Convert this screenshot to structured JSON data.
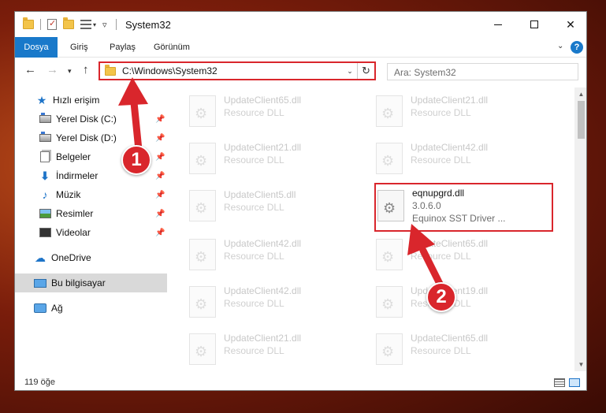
{
  "window": {
    "title": "System32",
    "controls": {
      "minimize_icon": "minimize-icon",
      "maximize_icon": "maximize-icon",
      "close_label": "✕"
    }
  },
  "ribbon": {
    "tabs": [
      {
        "label": "Dosya"
      },
      {
        "label": "Giriş"
      },
      {
        "label": "Paylaş"
      },
      {
        "label": "Görünüm"
      }
    ],
    "help_label": "?"
  },
  "nav": {
    "address": "C:\\Windows\\System32",
    "search_placeholder": "Ara: System32"
  },
  "sidebar": {
    "items": [
      {
        "label": "Hızlı erişim",
        "icon": "star-icon"
      },
      {
        "label": "Yerel Disk (C:)",
        "icon": "drive-icon",
        "pinned": true
      },
      {
        "label": "Yerel Disk (D:)",
        "icon": "drive-icon",
        "pinned": true
      },
      {
        "label": "Belgeler",
        "icon": "documents-icon",
        "pinned": true
      },
      {
        "label": "İndirmeler",
        "icon": "downloads-icon",
        "pinned": true
      },
      {
        "label": "Müzik",
        "icon": "music-icon",
        "pinned": true
      },
      {
        "label": "Resimler",
        "icon": "pictures-icon",
        "pinned": true
      },
      {
        "label": "Videolar",
        "icon": "videos-icon",
        "pinned": true
      },
      {
        "label": "OneDrive",
        "icon": "cloud-icon"
      },
      {
        "label": "Bu bilgisayar",
        "icon": "computer-icon",
        "selected": true
      },
      {
        "label": "Ağ",
        "icon": "network-icon"
      }
    ]
  },
  "files": [
    {
      "name": "UpdateClient65.dll",
      "type": "Resource DLL"
    },
    {
      "name": "UpdateClient21.dll",
      "type": "Resource DLL"
    },
    {
      "name": "UpdateClient21.dll",
      "type": "Resource DLL"
    },
    {
      "name": "UpdateClient42.dll",
      "type": "Resource DLL"
    },
    {
      "name": "UpdateClient5.dll",
      "type": "Resource DLL"
    },
    {
      "name": "eqnupgrd.dll",
      "version": "3.0.6.0",
      "type": "Equinox SST Driver ..."
    },
    {
      "name": "UpdateClient42.dll",
      "type": "Resource DLL"
    },
    {
      "name": "UpdateClient65.dll",
      "type": "Resource DLL"
    },
    {
      "name": "UpdateClient42.dll",
      "type": "Resource DLL"
    },
    {
      "name": "UpdateClient19.dll",
      "type": "Resource DLL"
    },
    {
      "name": "UpdateClient21.dll",
      "type": "Resource DLL"
    },
    {
      "name": "UpdateClient65.dll",
      "type": "Resource DLL"
    }
  ],
  "status": {
    "item_count": "119 öğe"
  },
  "annotations": {
    "step1": "1",
    "step2": "2",
    "accent_color": "#d9262c"
  }
}
